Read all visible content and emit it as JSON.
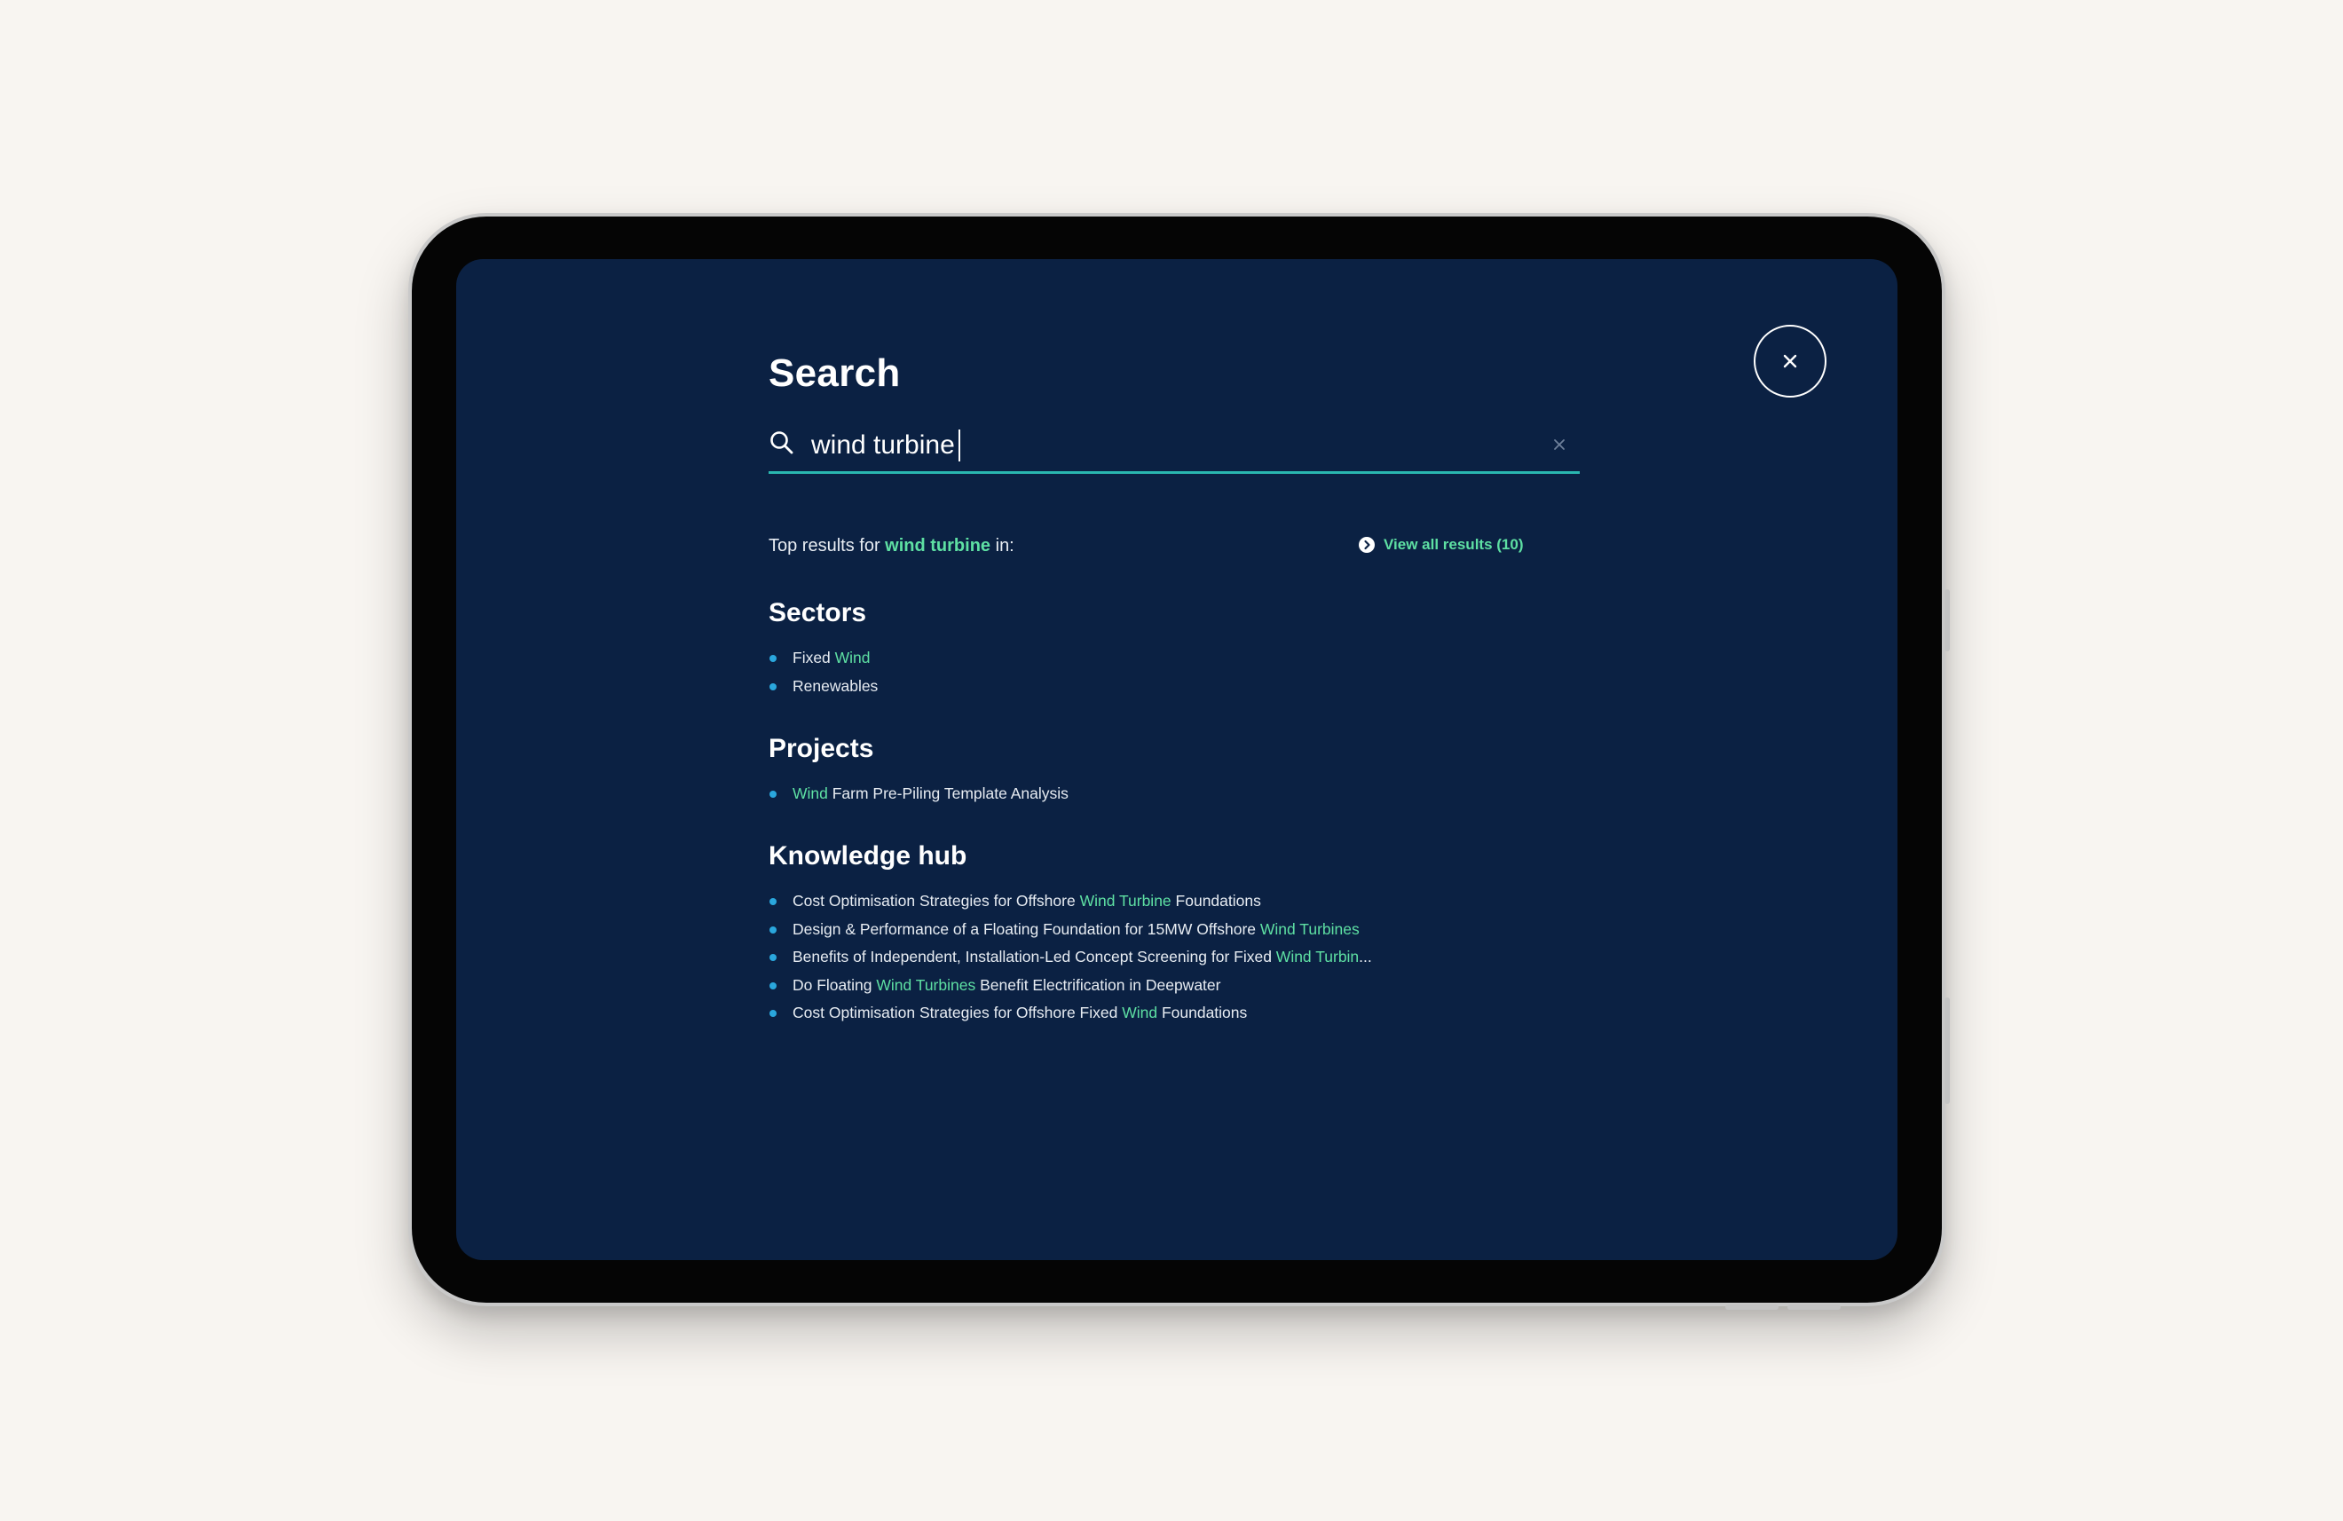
{
  "search": {
    "title": "Search",
    "query": "wind turbine",
    "placeholder": ""
  },
  "summary": {
    "prefix": "Top results for ",
    "term": "wind turbine",
    "suffix": " in:"
  },
  "view_all": {
    "label": "View all results (10)"
  },
  "sections": {
    "sectors": {
      "title": "Sectors",
      "items": [
        {
          "parts": [
            {
              "text": "Fixed "
            },
            {
              "text": "Wind",
              "hl": true
            }
          ]
        },
        {
          "parts": [
            {
              "text": "Renewables"
            }
          ]
        }
      ]
    },
    "projects": {
      "title": "Projects",
      "items": [
        {
          "parts": [
            {
              "text": "Wind",
              "hl": true
            },
            {
              "text": " Farm Pre-Piling Template Analysis"
            }
          ]
        }
      ]
    },
    "knowledge_hub": {
      "title": "Knowledge hub",
      "items": [
        {
          "parts": [
            {
              "text": "Cost Optimisation Strategies for Offshore "
            },
            {
              "text": "Wind Turbine",
              "hl": true
            },
            {
              "text": " Foundations"
            }
          ]
        },
        {
          "parts": [
            {
              "text": "Design & Performance of a Floating Foundation for 15MW Offshore "
            },
            {
              "text": "Wind Turbines",
              "hl": true
            }
          ]
        },
        {
          "parts": [
            {
              "text": "Benefits of Independent, Installation-Led Concept Screening for Fixed "
            },
            {
              "text": "Wind Turbin",
              "hl": true
            },
            {
              "text": "..."
            }
          ]
        },
        {
          "parts": [
            {
              "text": "Do Floating "
            },
            {
              "text": "Wind Turbines",
              "hl": true
            },
            {
              "text": " Benefit Electrification in Deepwater"
            }
          ]
        },
        {
          "parts": [
            {
              "text": "Cost Optimisation Strategies for Offshore Fixed "
            },
            {
              "text": "Wind",
              "hl": true
            },
            {
              "text": " Foundations"
            }
          ]
        }
      ]
    }
  },
  "colors": {
    "screen_bg": "#0b2143",
    "highlight": "#5ee0a3",
    "underline": "#2ab7b0",
    "bullet": "#2aa7dd"
  },
  "icons": {
    "close": "close-icon",
    "search": "search-icon",
    "clear": "clear-icon",
    "view_all": "chevron-right-circle-icon"
  }
}
